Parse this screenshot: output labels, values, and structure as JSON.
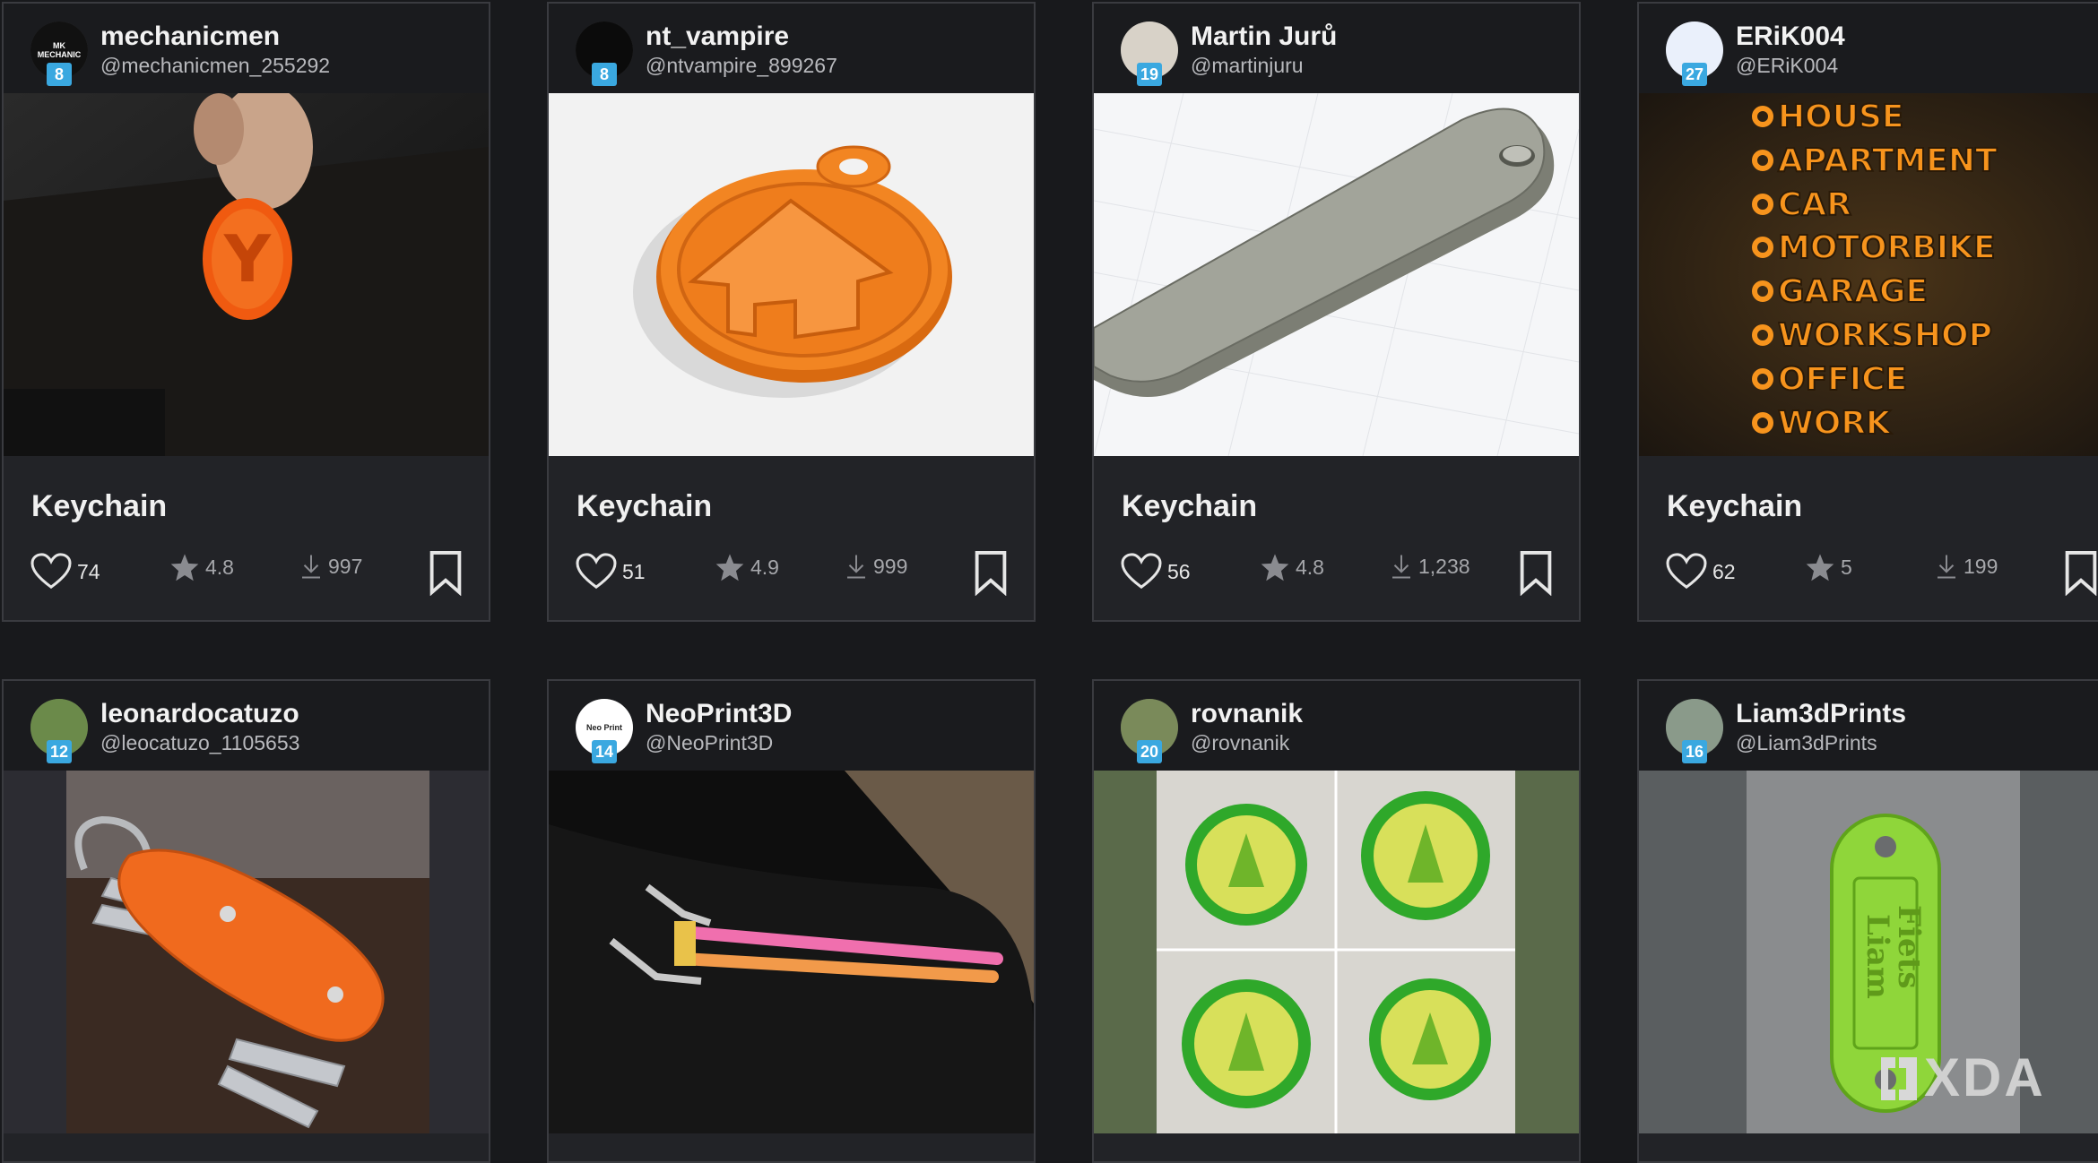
{
  "cards": [
    {
      "name": "mechanicmen",
      "handle": "@mechanicmen_255292",
      "level": "8",
      "avatar_text": "MK MECHANIC",
      "title": "Keychain",
      "likes": "74",
      "rating": "4.8",
      "downloads": "997"
    },
    {
      "name": "nt_vampire",
      "handle": "@ntvampire_899267",
      "level": "8",
      "avatar_text": "",
      "title": "Keychain",
      "likes": "51",
      "rating": "4.9",
      "downloads": "999"
    },
    {
      "name": "Martin Jurů",
      "handle": "@martinjuru",
      "level": "19",
      "avatar_text": "",
      "title": "Keychain",
      "likes": "56",
      "rating": "4.8",
      "downloads": "1,238"
    },
    {
      "name": "ERiK004",
      "handle": "@ERiK004",
      "level": "27",
      "avatar_text": "",
      "title": "Keychain",
      "likes": "62",
      "rating": "5",
      "downloads": "199",
      "image_text": [
        "HOUSE",
        "APARTMENT",
        "CAR",
        "MOTORBIKE",
        "GARAGE",
        "WORKSHOP",
        "OFFICE",
        "WORK"
      ]
    },
    {
      "name": "leonardocatuzo",
      "handle": "@leocatuzo_1105653",
      "level": "12",
      "avatar_text": ""
    },
    {
      "name": "NeoPrint3D",
      "handle": "@NeoPrint3D",
      "level": "14",
      "avatar_text": "Neo Print"
    },
    {
      "name": "rovnanik",
      "handle": "@rovnanik",
      "level": "20",
      "avatar_text": ""
    },
    {
      "name": "Liam3dPrints",
      "handle": "@Liam3dPrints",
      "level": "16",
      "avatar_text": "",
      "image_text": [
        "Fiets",
        "Liam"
      ]
    }
  ],
  "watermark": "XDA",
  "colors": {
    "background": "#18191c",
    "card": "#222327",
    "header": "#1a1b1e",
    "level_badge": "#3aa8e0",
    "orange": "#f07a1a",
    "green": "#4cbf2a"
  },
  "icons": {
    "like": "heart-icon",
    "rating": "star-icon",
    "downloads": "download-icon",
    "save": "bookmark-icon"
  }
}
